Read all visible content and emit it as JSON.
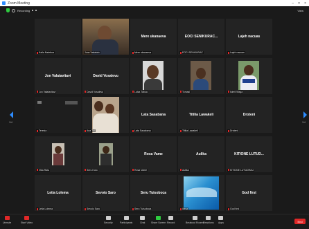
{
  "window": {
    "title": "Zoom Meeting",
    "controls": [
      "–",
      "□",
      "×"
    ]
  },
  "meeting_bar": {
    "recording_label": "Recording",
    "view_label": "View"
  },
  "tiles": [
    {
      "name": "",
      "label": "Kaila Natebua",
      "muted": true
    },
    {
      "name": "",
      "label": "Jone Vakalalo",
      "muted": false,
      "video": true,
      "active": true
    },
    {
      "name": "Mere ukanaeva",
      "label": "Mere ukanaeva",
      "muted": true
    },
    {
      "name": "EOCI SENIKURAC...",
      "label": "EOCI SENIKURAC",
      "muted": true
    },
    {
      "name": "Lajeh nacuas",
      "label": "Lajeh nacuas",
      "muted": true
    },
    {
      "name": "Jon Valatavitavi",
      "label": "Jon Valatavitavi",
      "muted": true
    },
    {
      "name": "David Vosalevu",
      "label": "David Vosalevu",
      "muted": true
    },
    {
      "name": "",
      "label": "Luisa Tabua",
      "muted": true,
      "video": true
    },
    {
      "name": "",
      "label": "Tomasi",
      "muted": true,
      "video": true
    },
    {
      "name": "",
      "label": "Isireli Waqa",
      "muted": true,
      "video": true
    },
    {
      "name": "",
      "label": "Teresia",
      "muted": true,
      "video": true
    },
    {
      "name": "",
      "label": "Ana Tui",
      "muted": true,
      "video": true
    },
    {
      "name": "Lata Sasabana",
      "label": "Lata Sasabana",
      "muted": true
    },
    {
      "name": "Titilia Lawakeli",
      "label": "Titilia Lawakeli",
      "muted": true
    },
    {
      "name": "Droteni",
      "label": "Droteni",
      "muted": true
    },
    {
      "name": "",
      "label": "Vika Ratu",
      "muted": true,
      "video": true
    },
    {
      "name": "",
      "label": "Seru Koro",
      "muted": true,
      "video": true
    },
    {
      "name": "Rosa Vame",
      "label": "Rosa Vame",
      "muted": true
    },
    {
      "name": "Aulika",
      "label": "Aulika",
      "muted": true
    },
    {
      "name": "KITIONE LUTUD...",
      "label": "KITIONE LUTUDRAU",
      "muted": true
    },
    {
      "name": "Letia Lolema",
      "label": "Letia Lolema",
      "muted": true
    },
    {
      "name": "Sevoio Saro",
      "label": "Sevoio Saro",
      "muted": true
    },
    {
      "name": "Seru Tuisoboca",
      "label": "Seru Tuisoboca",
      "muted": true
    },
    {
      "name": "",
      "label": "Iliesa",
      "muted": true,
      "video": true
    },
    {
      "name": "God first",
      "label": "God first",
      "muted": true
    }
  ],
  "nav": {
    "left_page": "1/4",
    "right_page": "1/4"
  },
  "toolbar": {
    "unmute": "Unmute",
    "start_video": "Start Video",
    "security": "Security",
    "participants": "Participants",
    "chat": "Chat",
    "share_screen": "Share Screen",
    "record": "Record",
    "breakout": "Breakout Rooms",
    "reactions": "Reactions",
    "apps": "Apps",
    "end": "End"
  }
}
